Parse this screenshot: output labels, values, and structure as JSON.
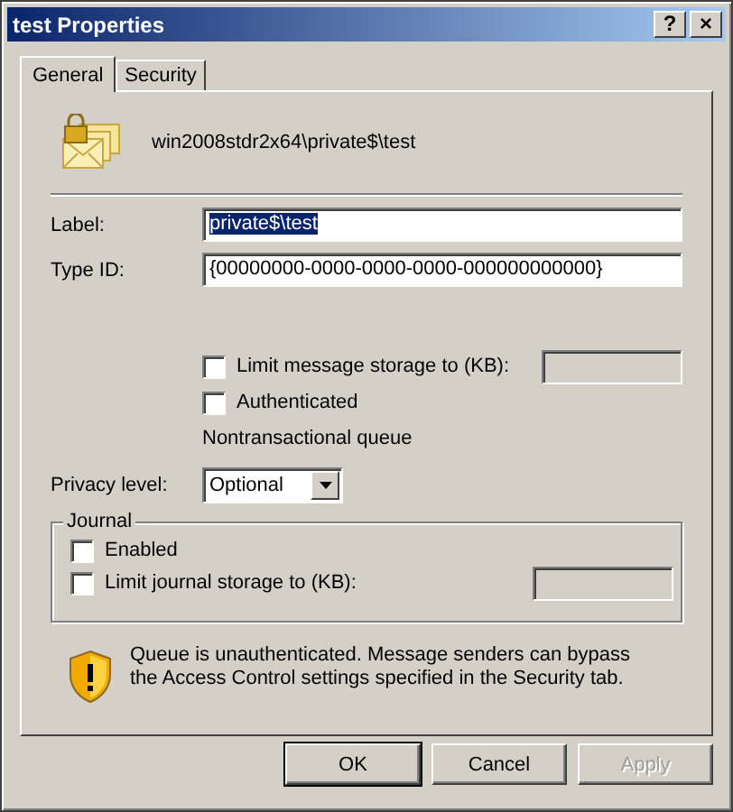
{
  "window": {
    "title": "test Properties",
    "title_buttons": [
      "?",
      "×"
    ]
  },
  "tabs": [
    {
      "label": "General",
      "selected": true
    },
    {
      "label": "Security",
      "selected": false
    }
  ],
  "queue_path": "win2008stdr2x64\\private$\\test",
  "fields": [
    {
      "label": "Label:",
      "value": "private$\\test",
      "text_selected": true
    },
    {
      "label": "Type ID:",
      "value": "{00000000-0000-0000-0000-000000000000}",
      "text_selected": false
    }
  ],
  "options": [
    {
      "kind": "checkbox-field",
      "label": "Limit message storage to (KB):",
      "checked": false
    },
    {
      "kind": "checkbox",
      "label": "Authenticated",
      "checked": false
    },
    {
      "kind": "note",
      "label": "Nontransactional queue"
    }
  ],
  "privacy": {
    "label": "Privacy level:",
    "value": "Optional"
  },
  "journal": {
    "legend": "Journal",
    "options": [
      {
        "kind": "checkbox",
        "label": "Enabled",
        "checked": false
      },
      {
        "kind": "checkbox-field",
        "label": "Limit journal storage to (KB):",
        "checked": false
      }
    ]
  },
  "warning": "Queue is unauthenticated. Message senders can bypass the Access Control settings specified in the Security tab.",
  "buttons": [
    {
      "label": "OK",
      "disabled": false,
      "default": true
    },
    {
      "label": "Cancel",
      "disabled": false,
      "default": false
    },
    {
      "label": "Apply",
      "disabled": true,
      "default": false
    }
  ]
}
